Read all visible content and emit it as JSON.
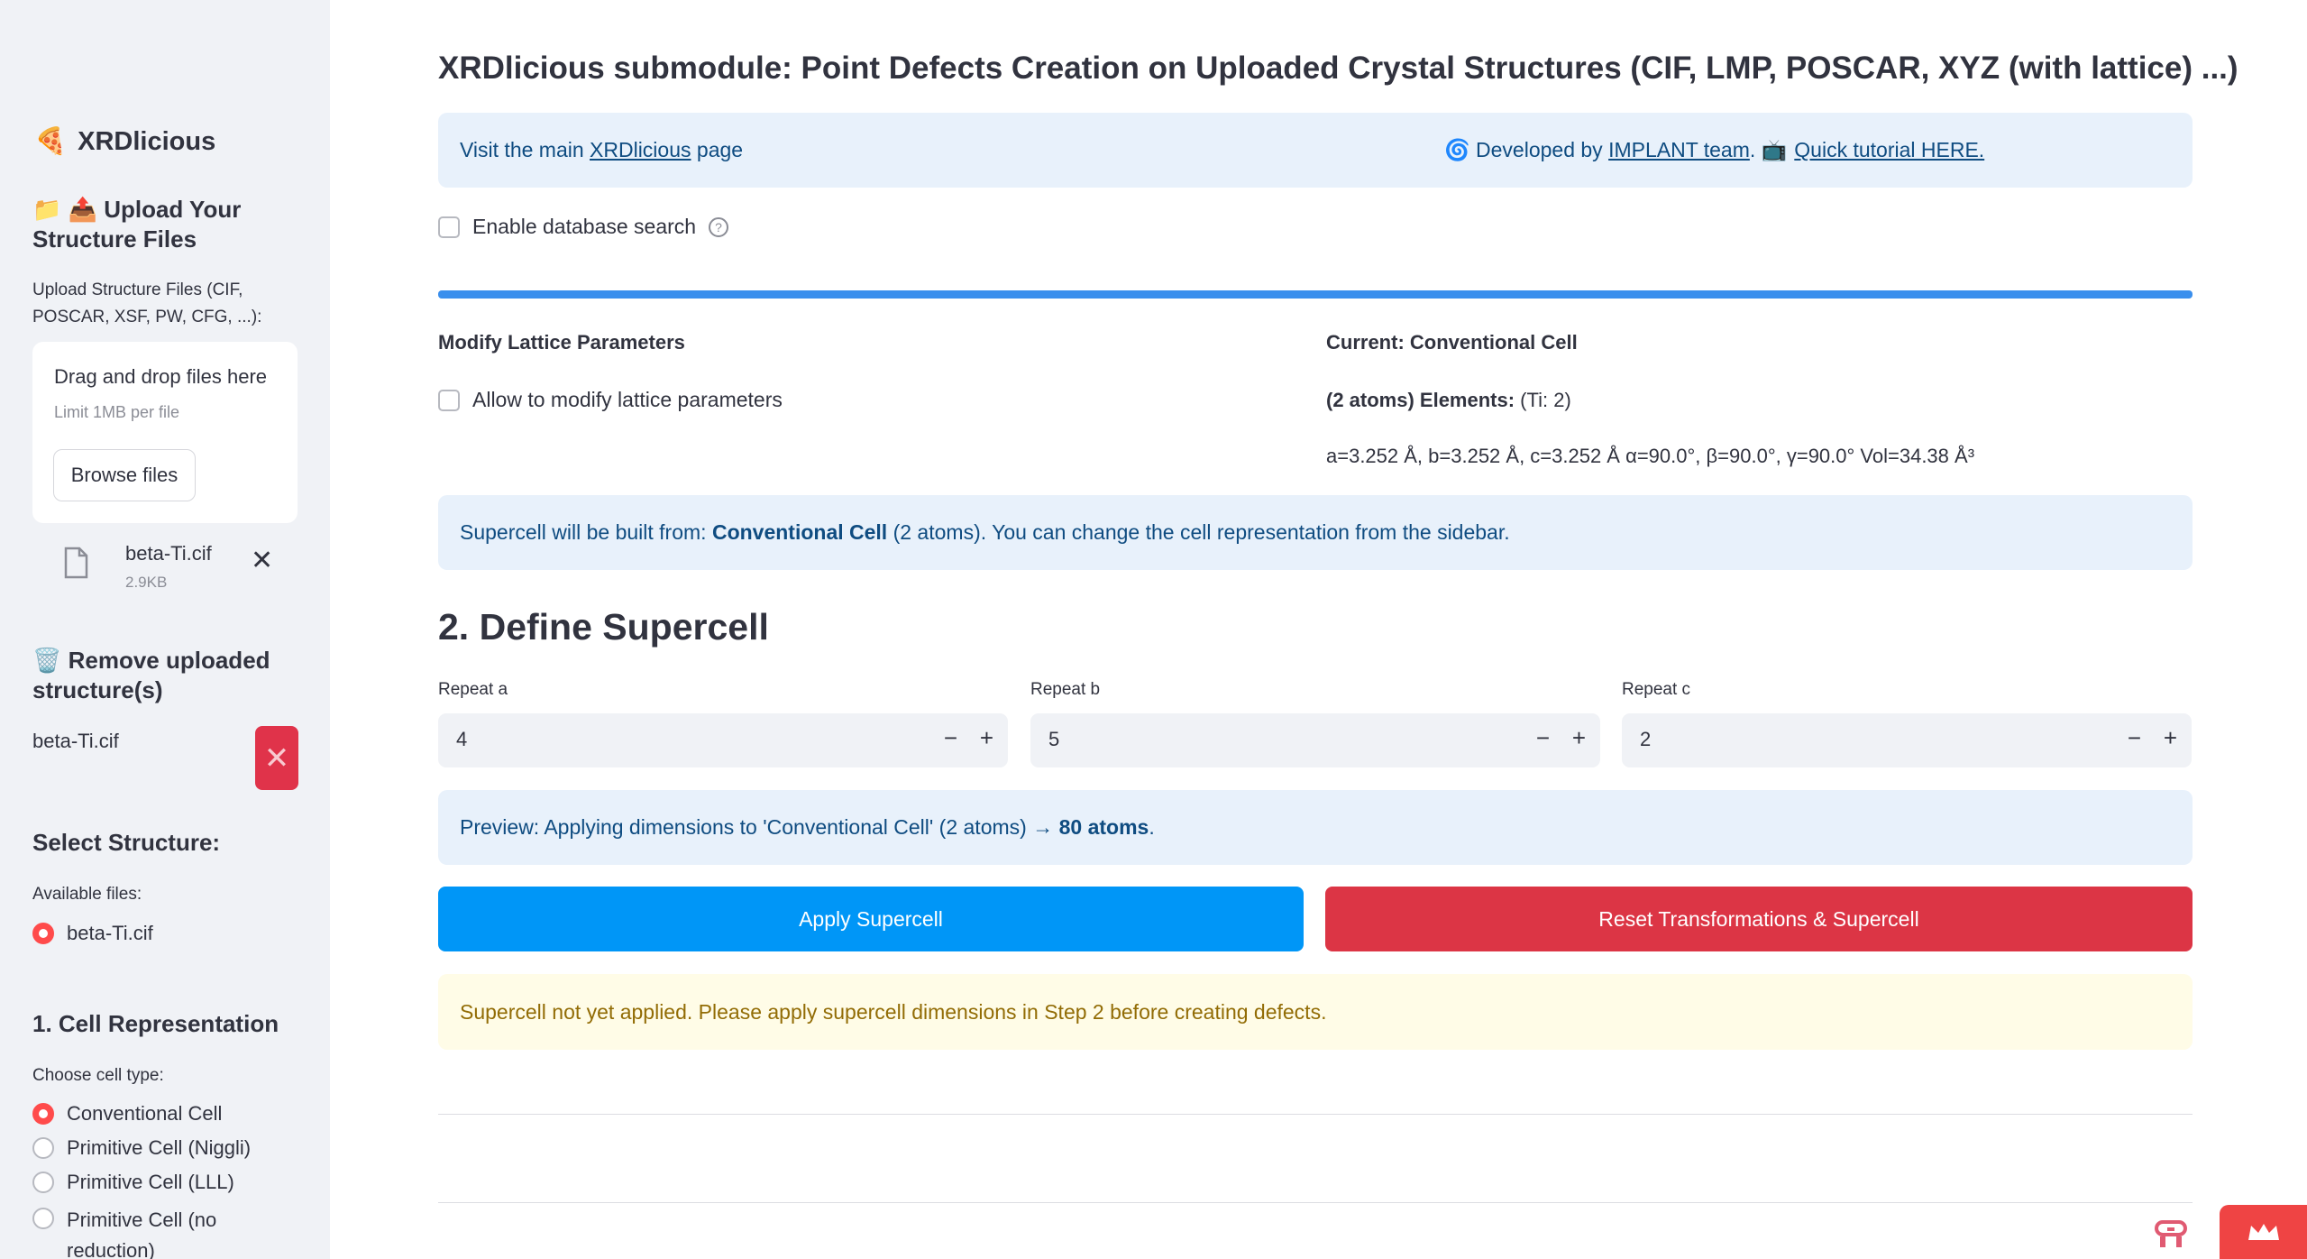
{
  "sidebar": {
    "brand": {
      "icon": "🍕",
      "label": "XRDlicious"
    },
    "upload_heading": "📁 📤 Upload Your Structure Files",
    "upload_label": "Upload Structure Files (CIF, POSCAR, XSF, PW, CFG, ...):",
    "dropzone": {
      "title": "Drag and drop files here",
      "limit": "Limit 1MB per file",
      "browse_label": "Browse files"
    },
    "uploaded_file": {
      "name": "beta-Ti.cif",
      "size": "2.9KB",
      "icon": "file-icon",
      "remove_icon": "close-icon"
    },
    "remove_heading": "🗑️ Remove uploaded structure(s)",
    "remove_item": {
      "name": "beta-Ti.cif",
      "icon": "x-icon"
    },
    "select_heading": "Select Structure:",
    "available_label": "Available files:",
    "available_files": [
      {
        "label": "beta-Ti.cif",
        "selected": true
      }
    ],
    "cell_heading": "1. Cell Representation",
    "cell_label": "Choose cell type:",
    "cell_options": [
      {
        "label": "Conventional Cell",
        "selected": true
      },
      {
        "label": "Primitive Cell (Niggli)",
        "selected": false
      },
      {
        "label": "Primitive Cell (LLL)",
        "selected": false
      },
      {
        "label": "Primitive Cell (no reduction)",
        "selected": false
      }
    ]
  },
  "main": {
    "title": "XRDlicious submodule: Point Defects Creation on Uploaded Crystal Structures (CIF, LMP, POSCAR, XYZ (with lattice) ...)",
    "visit": {
      "prefix": "Visit the main ",
      "link": "XRDlicious",
      "suffix": " page"
    },
    "developed": {
      "icon1": "🌀",
      "prefix": " Developed by ",
      "link": "IMPLANT team",
      "mid": ". ",
      "icon2": "📺",
      "link2": "Quick tutorial HERE."
    },
    "db_search_label": "Enable database search",
    "progress_fraction": 1.0,
    "lattice_heading": "Modify Lattice Parameters",
    "lattice_checkbox": "Allow to modify lattice parameters",
    "current_heading": "Current: Conventional Cell",
    "elements": {
      "bold": "(2 atoms) Elements:",
      "rest": " (Ti: 2)"
    },
    "lattice_params": "a=3.252 Å, b=3.252 Å, c=3.252 Å α=90.0°, β=90.0°, γ=90.0° Vol=34.38 Å³",
    "supercell_info": {
      "prefix": "Supercell will be built from: ",
      "bold": "Conventional Cell",
      "suffix": " (2 atoms). You can change the cell representation from the sidebar."
    },
    "define_heading": "2. Define Supercell",
    "repeat": [
      {
        "label": "Repeat a",
        "value": "4"
      },
      {
        "label": "Repeat b",
        "value": "5"
      },
      {
        "label": "Repeat c",
        "value": "2"
      }
    ],
    "preview": {
      "prefix": "Preview: Applying dimensions to 'Conventional Cell' (2 atoms) → ",
      "bold": "80 atoms",
      "suffix": "."
    },
    "apply_label": "Apply Supercell",
    "reset_label": "Reset Transformations & Supercell",
    "warning": "Supercell not yet applied. Please apply supercell dimensions in Step 2 before creating defects."
  },
  "colors": {
    "accent_blue": "#0096f7",
    "danger_red": "#dc3545",
    "info_bg": "#e8f1fb",
    "warn_bg": "#fffce7"
  }
}
